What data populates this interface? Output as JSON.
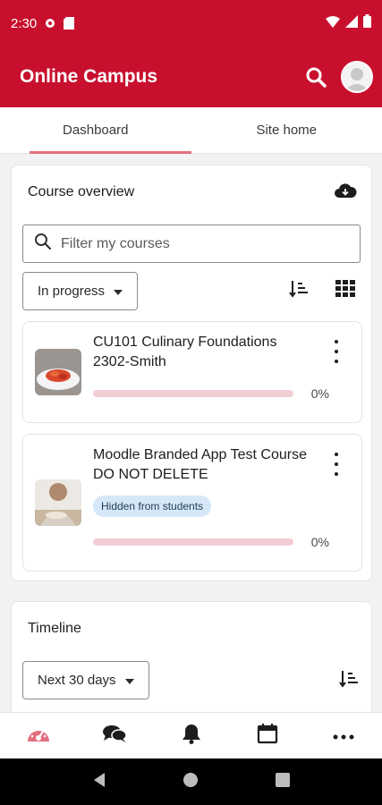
{
  "status": {
    "time": "2:30"
  },
  "appbar": {
    "title": "Online Campus"
  },
  "tabs": [
    {
      "label": "Dashboard"
    },
    {
      "label": "Site home"
    }
  ],
  "overview": {
    "title": "Course overview",
    "search_placeholder": "Filter my courses",
    "filter_label": "In progress",
    "courses": [
      {
        "name": "CU101 Culinary Foundations 2302-Smith",
        "progress": "0%"
      },
      {
        "name": "Moodle Branded App Test Course DO NOT DELETE",
        "badge": "Hidden from students",
        "progress": "0%"
      }
    ]
  },
  "timeline": {
    "title": "Timeline",
    "filter_label": "Next 30 days"
  },
  "colors": {
    "brand": "#c8102e",
    "progress_track": "#f3cdd4",
    "active_accent": "#e36e7e"
  }
}
